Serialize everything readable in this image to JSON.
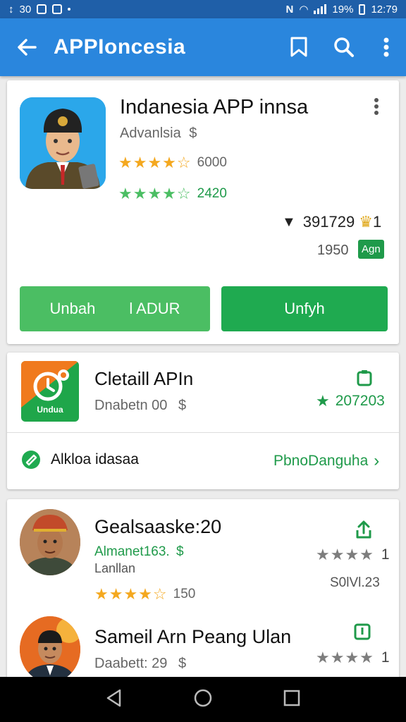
{
  "status_bar": {
    "left_text": "30",
    "battery": "19%",
    "time": "12:79"
  },
  "app_bar": {
    "title": "APPIoncesia"
  },
  "featured": {
    "title": "Indanesia APP innsa",
    "developer": "Advanlsia",
    "rating_count_1": "6000",
    "rating_count_2": "2420",
    "stat_value": "391729",
    "stat_badge": "1",
    "size_text": "1950",
    "age_tag": "Agn",
    "button_left": "Unbah",
    "button_left_extra": "l ADUR",
    "button_right": "Unfyh"
  },
  "detail_card": {
    "icon_label": "Undua",
    "title": "Cletaill APIn",
    "subtitle": "Dnabetn 00",
    "rating_value": "207203",
    "link_text": "Alkloa idasaa",
    "link_action": "PbnoDanguha"
  },
  "list": [
    {
      "title": "Gealsaaske:20",
      "green_line": "Almanet163.",
      "sub_line": "Lanllan",
      "star_count": "150",
      "right_rating": "1",
      "right_text": "S0lVl.23",
      "stars": 4
    },
    {
      "title": "Sameil Arn Peang Ulan",
      "sub_line": "Daabett: 29",
      "right_rating": "1",
      "stars": 4
    }
  ],
  "colors": {
    "status_bar": "#1f5fa8",
    "app_bar": "#2a86dd",
    "primary_green": "#1faa50",
    "light_green": "#4bbe63",
    "star_orange": "#f4a81f",
    "star_grey": "#7d7d7d"
  }
}
